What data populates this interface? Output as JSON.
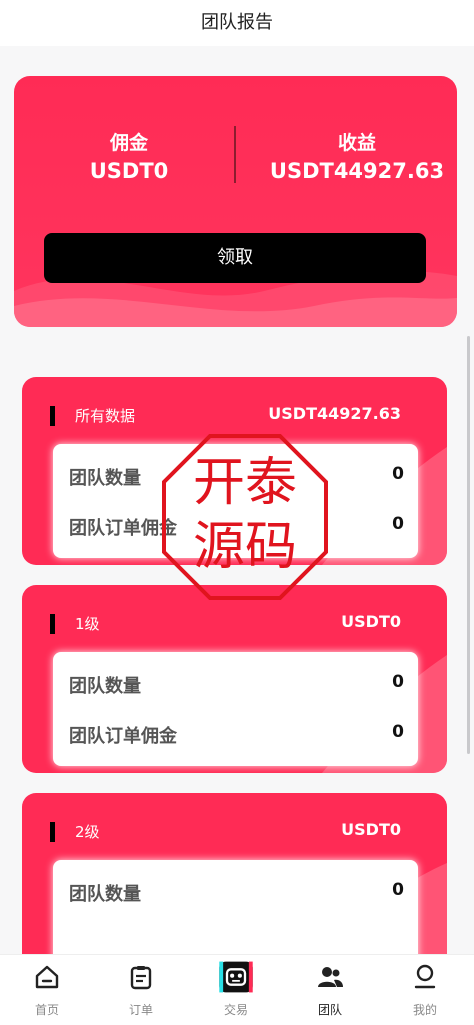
{
  "header": {
    "title": "团队报告"
  },
  "summary": {
    "commission_label": "佣金",
    "commission_value": "USDT0",
    "income_label": "收益",
    "income_value": "USDT44927.63",
    "claim_button": "领取"
  },
  "cards": [
    {
      "title": "所有数据",
      "amount": "USDT44927.63",
      "rows": [
        {
          "label": "团队数量",
          "value": "0"
        },
        {
          "label": "团队订单佣金",
          "value": "0"
        }
      ]
    },
    {
      "title": "1级",
      "amount": "USDT0",
      "rows": [
        {
          "label": "团队数量",
          "value": "0"
        },
        {
          "label": "团队订单佣金",
          "value": "0"
        }
      ]
    },
    {
      "title": "2级",
      "amount": "USDT0",
      "rows": [
        {
          "label": "团队数量",
          "value": "0"
        }
      ]
    }
  ],
  "watermark": {
    "text": "开泰源码"
  },
  "tabbar": {
    "items": [
      {
        "label": "首页",
        "icon": "home-icon"
      },
      {
        "label": "订单",
        "icon": "clipboard-icon"
      },
      {
        "label": "交易",
        "icon": "robot-icon"
      },
      {
        "label": "团队",
        "icon": "team-icon",
        "active": true
      },
      {
        "label": "我的",
        "icon": "user-icon"
      }
    ]
  },
  "colors": {
    "accent": "#ff2b55",
    "button": "#000000",
    "watermark": "#e0141e"
  }
}
